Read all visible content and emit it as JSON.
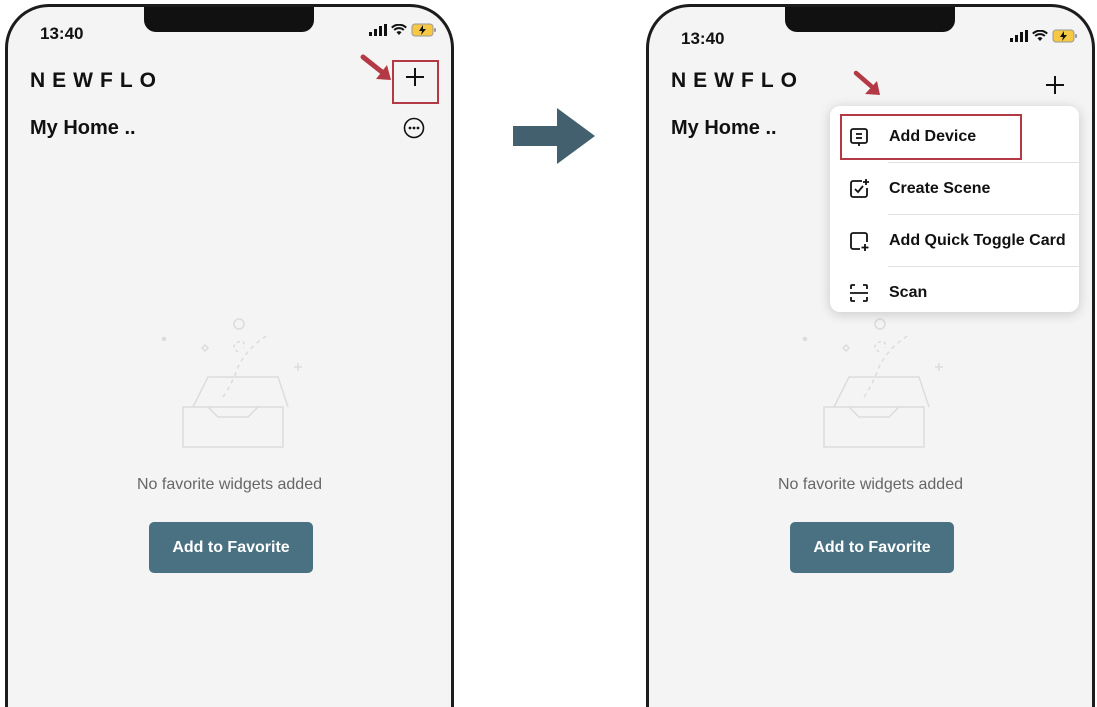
{
  "status_bar": {
    "time": "13:40"
  },
  "app": {
    "brand": "NEWFLO",
    "home_title": "My Home .."
  },
  "empty_state": {
    "message": "No favorite widgets added",
    "button_label": "Add to Favorite"
  },
  "menu": {
    "items": [
      {
        "label": "Add Device",
        "icon": "add-device-icon"
      },
      {
        "label": "Create Scene",
        "icon": "create-scene-icon"
      },
      {
        "label": "Add Quick Toggle Card",
        "icon": "quick-toggle-card-icon"
      },
      {
        "label": "Scan",
        "icon": "scan-icon"
      }
    ]
  },
  "colors": {
    "accent_button": "#4a7182",
    "annotation_red": "#b33a45",
    "flow_arrow": "#43606f"
  }
}
